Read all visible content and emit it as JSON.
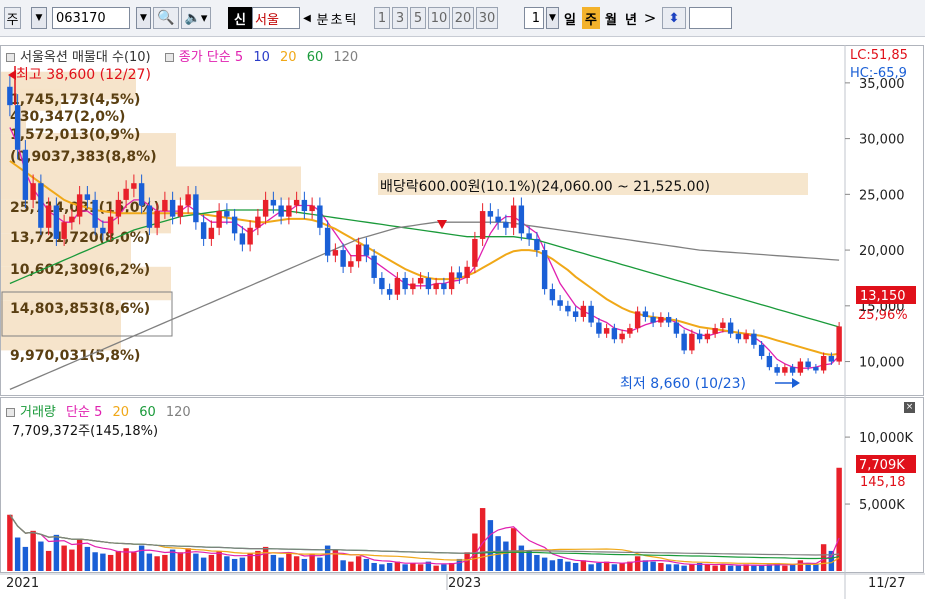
{
  "toolbar": {
    "market_label": "주",
    "code": "063170",
    "badge": "신",
    "stock_name": "서울",
    "period_buttons": [
      "분",
      "초",
      "틱"
    ],
    "interval_buttons": [
      "1",
      "3",
      "5",
      "10",
      "20",
      "30"
    ],
    "count_value": "1",
    "period_tabs": [
      "일",
      "주",
      "월",
      "년"
    ],
    "active_tab": "주"
  },
  "price_panel": {
    "title": "서울옥션 매물대 수(10)",
    "ma_label": "종가 단순",
    "ma_periods": [
      "5",
      "10",
      "20",
      "60",
      "120"
    ],
    "lc_label": "LC:51,85",
    "hc_label": "HC:-65,9",
    "high_annotation": "최고 38,600 (12/27)",
    "low_annotation": "최저 8,660 (10/23)",
    "dividend_annotation": "배당락600.00원(10.1%)(24,060.00 ~ 21,525.00)",
    "current_price": "13,150",
    "current_change": "25,96%",
    "y_ticks": [
      "35,000",
      "30,000",
      "25,000",
      "20,000",
      "15,000",
      "10,000"
    ],
    "volume_profile": [
      "1,745,173(4,5%)",
      "430,347(2,0%)",
      "1,572,013(0,9%)",
      "(0,9037,383(8,8%)",
      "25,714,031(15,0%)",
      "13,721,720(8,0%)",
      "10,602,309(6,2%)",
      "14,803,853(8,6%)",
      "9,970,031(5,8%)"
    ]
  },
  "volume_panel": {
    "title": "거래량",
    "ma_label": "단순",
    "ma_periods": [
      "5",
      "20",
      "60",
      "120"
    ],
    "last_volume": "7,709,372주(145,18%)",
    "current_volume": "7,709K",
    "current_ratio": "145,18",
    "y_ticks": [
      "10,000K",
      "5,000K"
    ]
  },
  "x_axis": {
    "labels": [
      "2021",
      "2023"
    ],
    "last_date": "11/27"
  },
  "colors": {
    "up": "#e8202a",
    "down": "#1a5fd6",
    "ma5": "#e020b0",
    "ma10": "#2a3cc8",
    "ma20": "#f0a818",
    "ma60": "#1a9a3a",
    "ma120": "#808080",
    "profile": "#f5e3c8"
  },
  "chart_data": {
    "type": "candlestick",
    "period": "weekly",
    "ylim": [
      7000,
      37500
    ],
    "price_series": [
      {
        "name": "종가",
        "values": [
          33000,
          29000,
          24500,
          26000,
          22000,
          24000,
          21000,
          22500,
          23000,
          25000,
          24500,
          22000,
          21500,
          23000,
          24500,
          25500,
          26000,
          24000,
          22000,
          23500,
          24500,
          23000,
          24000,
          25000,
          22500,
          21000,
          22000,
          23500,
          23000,
          21500,
          20500,
          22000,
          23000,
          24500,
          24000,
          23000,
          24000,
          24500,
          23500,
          24000,
          22000,
          19500,
          20000,
          18500,
          19000,
          20500,
          19500,
          17500,
          16500,
          16000,
          17500,
          16500,
          17000,
          17500,
          16500,
          17000,
          16500,
          18000,
          17500,
          18500,
          21000,
          23500,
          23000,
          22500,
          22000,
          24000,
          21500,
          21000,
          20000,
          16500,
          15500,
          15000,
          14500,
          14000,
          15000,
          13500,
          12500,
          13000,
          12000,
          12500,
          13000,
          14500,
          14000,
          13500,
          14000,
          13500,
          12500,
          11000,
          12500,
          12000,
          12500,
          13000,
          13500,
          12500,
          12000,
          12500,
          11500,
          10500,
          9500,
          9000,
          9500,
          9000,
          10000,
          9500,
          9200,
          10500,
          10000,
          13150
        ]
      },
      {
        "name": "5",
        "values": [
          31000,
          29500,
          27000,
          25500,
          24500,
          23500,
          23000,
          22500,
          22500,
          23500,
          23500,
          23000,
          22500,
          22500,
          23000,
          24000,
          24500,
          24500,
          24000,
          23500,
          23500,
          23500,
          23500,
          24000,
          23500,
          23000,
          22500,
          22500,
          22500,
          22500,
          22000,
          21500,
          22000,
          22500,
          23000,
          23500,
          23500,
          24000,
          24000,
          24000,
          23500,
          22500,
          21500,
          20500,
          19500,
          19500,
          19500,
          19000,
          18500,
          18000,
          17500,
          17000,
          16800,
          16800,
          16800,
          17000,
          17000,
          17200,
          17300,
          17600,
          18500,
          20000,
          21500,
          22500,
          23000,
          23000,
          22500,
          22000,
          21500,
          20000,
          18500,
          17000,
          16000,
          15000,
          14500,
          14200,
          13800,
          13500,
          13000,
          12800,
          12700,
          13000,
          13300,
          13500,
          13700,
          13800,
          13500,
          13000,
          12700,
          12400,
          12300,
          12500,
          12700,
          12700,
          12600,
          12500,
          12200,
          11700,
          11000,
          10200,
          9800,
          9500,
          9400,
          9400,
          9500,
          9700,
          9800,
          10500
        ]
      },
      {
        "name": "20",
        "values": [
          28000,
          27500,
          27000,
          26500,
          26000,
          25500,
          25000,
          24500,
          24200,
          24000,
          23800,
          23600,
          23500,
          23400,
          23300,
          23300,
          23300,
          23300,
          23300,
          23300,
          23300,
          23300,
          23300,
          23300,
          23300,
          23200,
          23100,
          23000,
          22900,
          22800,
          22700,
          22600,
          22500,
          22500,
          22600,
          22700,
          22800,
          22800,
          22800,
          22700,
          22500,
          22200,
          21900,
          21500,
          21100,
          20700,
          20300,
          19900,
          19500,
          19100,
          18700,
          18300,
          18000,
          17700,
          17500,
          17400,
          17400,
          17400,
          17500,
          17700,
          18000,
          18400,
          18800,
          19200,
          19600,
          19900,
          20000,
          20000,
          19900,
          19600,
          19200,
          18700,
          18200,
          17600,
          17100,
          16600,
          16100,
          15600,
          15200,
          14800,
          14500,
          14300,
          14100,
          14000,
          13900,
          13800,
          13700,
          13500,
          13300,
          13100,
          13000,
          12900,
          12800,
          12700,
          12600,
          12500,
          12400,
          12300,
          12100,
          11900,
          11700,
          11500,
          11300,
          11100,
          10900,
          10700,
          10600,
          10700
        ]
      },
      {
        "name": "60",
        "values": [
          17000,
          17300,
          17600,
          17900,
          18200,
          18500,
          18800,
          19100,
          19400,
          19700,
          20000,
          20300,
          20600,
          20900,
          21200,
          21500,
          21800,
          22000,
          22200,
          22400,
          22600,
          22800,
          23000,
          23100,
          23200,
          23300,
          23400,
          23500,
          23600,
          23600,
          23600,
          23600,
          23600,
          23600,
          23600,
          23600,
          23500,
          23400,
          23300,
          23200,
          23100,
          23000,
          22900,
          22800,
          22700,
          22600,
          22500,
          22400,
          22300,
          22200,
          22100,
          22000,
          21900,
          21800,
          21700,
          21600,
          21500,
          21400,
          21300,
          21200,
          21200,
          21200,
          21200,
          21200,
          21200,
          21200,
          21100,
          21000,
          20900,
          20700,
          20500,
          20300,
          20100,
          19900,
          19700,
          19500,
          19300,
          19100,
          18900,
          18700,
          18500,
          18300,
          18100,
          17900,
          17700,
          17500,
          17300,
          17100,
          16900,
          16700,
          16500,
          16300,
          16100,
          15900,
          15700,
          15500,
          15300,
          15100,
          14900,
          14700,
          14500,
          14300,
          14100,
          13900,
          13700,
          13500,
          13300,
          13100
        ]
      },
      {
        "name": "120",
        "values": [
          7500,
          7800,
          8100,
          8400,
          8700,
          9000,
          9300,
          9600,
          9900,
          10200,
          10500,
          10800,
          11100,
          11400,
          11700,
          12000,
          12300,
          12600,
          12900,
          13200,
          13500,
          13800,
          14100,
          14400,
          14700,
          15000,
          15300,
          15600,
          15900,
          16200,
          16500,
          16800,
          17100,
          17400,
          17700,
          18000,
          18300,
          18600,
          18900,
          19200,
          19500,
          19800,
          20100,
          20400,
          20700,
          21000,
          21200,
          21400,
          21600,
          21800,
          22000,
          22100,
          22200,
          22300,
          22400,
          22500,
          22500,
          22500,
          22500,
          22500,
          22500,
          22500,
          22500,
          22500,
          22500,
          22400,
          22300,
          22200,
          22100,
          22000,
          21900,
          21800,
          21700,
          21600,
          21500,
          21400,
          21300,
          21200,
          21100,
          21000,
          20900,
          20800,
          20700,
          20600,
          20500,
          20400,
          20300,
          20200,
          20100,
          20000,
          19950,
          19900,
          19850,
          19800,
          19750,
          19700,
          19650,
          19600,
          19550,
          19500,
          19450,
          19400,
          19350,
          19300,
          19250,
          19200,
          19150,
          19100
        ]
      }
    ],
    "volume_values": [
      4200,
      2500,
      1800,
      3000,
      2200,
      1500,
      2700,
      1900,
      1600,
      2400,
      1800,
      1400,
      1300,
      1200,
      1500,
      1700,
      1400,
      1900,
      1300,
      1100,
      1200,
      1600,
      1400,
      1700,
      1300,
      1000,
      1200,
      1500,
      1100,
      900,
      1000,
      1300,
      1500,
      1800,
      1200,
      1000,
      1400,
      1100,
      900,
      1300,
      1000,
      1900,
      1600,
      800,
      700,
      1100,
      900,
      600,
      500,
      600,
      700,
      500,
      600,
      500,
      700,
      400,
      500,
      600,
      900,
      1400,
      2800,
      4700,
      3800,
      2600,
      2200,
      3200,
      1900,
      1500,
      1200,
      1000,
      800,
      900,
      700,
      600,
      800,
      500,
      600,
      700,
      500,
      600,
      700,
      1100,
      800,
      700,
      600,
      500,
      500,
      400,
      500,
      600,
      500,
      400,
      500,
      400,
      400,
      500,
      400,
      400,
      500,
      600,
      400,
      500,
      800,
      600,
      500,
      2000,
      1500,
      7709
    ]
  }
}
